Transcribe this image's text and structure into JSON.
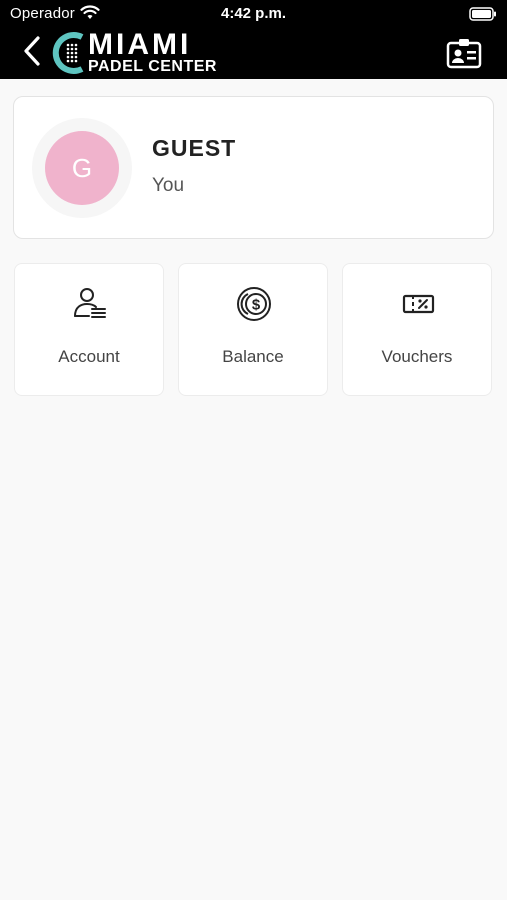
{
  "status_bar": {
    "carrier": "Operador",
    "time": "4:42 p.m."
  },
  "header": {
    "logo_word": "MIAMI",
    "logo_sub": "PADEL CENTER",
    "colors": {
      "background": "#000000",
      "accent": "#5ec4c0"
    }
  },
  "profile": {
    "initial": "G",
    "name": "GUEST",
    "subtitle": "You",
    "avatar_color": "#f0b3cc"
  },
  "tiles": [
    {
      "label": "Account",
      "icon": "user-list-icon"
    },
    {
      "label": "Balance",
      "icon": "dollar-coin-icon"
    },
    {
      "label": "Vouchers",
      "icon": "voucher-percent-icon"
    }
  ]
}
